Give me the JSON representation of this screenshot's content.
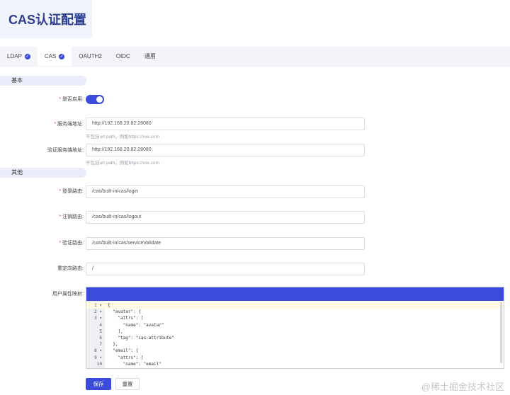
{
  "page": {
    "title": "CAS认证配置"
  },
  "tabs": [
    {
      "label": "LDAP",
      "checked": true
    },
    {
      "label": "CAS",
      "checked": true
    },
    {
      "label": "OAUTH2",
      "checked": false
    },
    {
      "label": "OIDC",
      "checked": false
    },
    {
      "label": "通用",
      "checked": false
    }
  ],
  "sections": {
    "basic": "基本",
    "other": "其他"
  },
  "form": {
    "required_mark": "*",
    "enabled": {
      "label": "是否启用:",
      "value": true
    },
    "server_url": {
      "label": "服务端地址:",
      "value": "http://192.168.20.82:28080",
      "hint": "不包括url path，例如https://xxx.com"
    },
    "validate_url": {
      "label": "验证服务端地址:",
      "value": "http://192.168.20.82:28080",
      "hint": "不包括url path，例如https://xxx.com"
    },
    "login_route": {
      "label": "登录路由:",
      "value": "/cas/built-in/cas/login"
    },
    "logout_route": {
      "label": "注销路由:",
      "value": "/cas/built-in/cas/logout"
    },
    "validate_route": {
      "label": "验证路由:",
      "value": "/cas/built-in/cas/serviceValidate"
    },
    "redirect_route": {
      "label": "重定向路由:",
      "value": "/"
    },
    "user_attr_map": {
      "label": "用户属性映射:"
    }
  },
  "editor": {
    "lines": [
      {
        "n": "1",
        "fold": true,
        "text": "{"
      },
      {
        "n": "2",
        "fold": true,
        "text": "  \"avatar\": {"
      },
      {
        "n": "3",
        "fold": true,
        "text": "    \"attrs\": ["
      },
      {
        "n": "4",
        "fold": false,
        "text": "      \"name\": \"avatar\""
      },
      {
        "n": "5",
        "fold": false,
        "text": "    ],"
      },
      {
        "n": "6",
        "fold": false,
        "text": "    \"tag\": \"cas:attribute\""
      },
      {
        "n": "7",
        "fold": false,
        "text": "  },"
      },
      {
        "n": "8",
        "fold": true,
        "text": "  \"email\": {"
      },
      {
        "n": "9",
        "fold": true,
        "text": "    \"attrs\": ["
      },
      {
        "n": "10",
        "fold": false,
        "text": "      \"name\": \"email\""
      }
    ]
  },
  "buttons": {
    "save": "保存",
    "reset": "重置"
  },
  "watermark": "@稀土掘金技术社区"
}
